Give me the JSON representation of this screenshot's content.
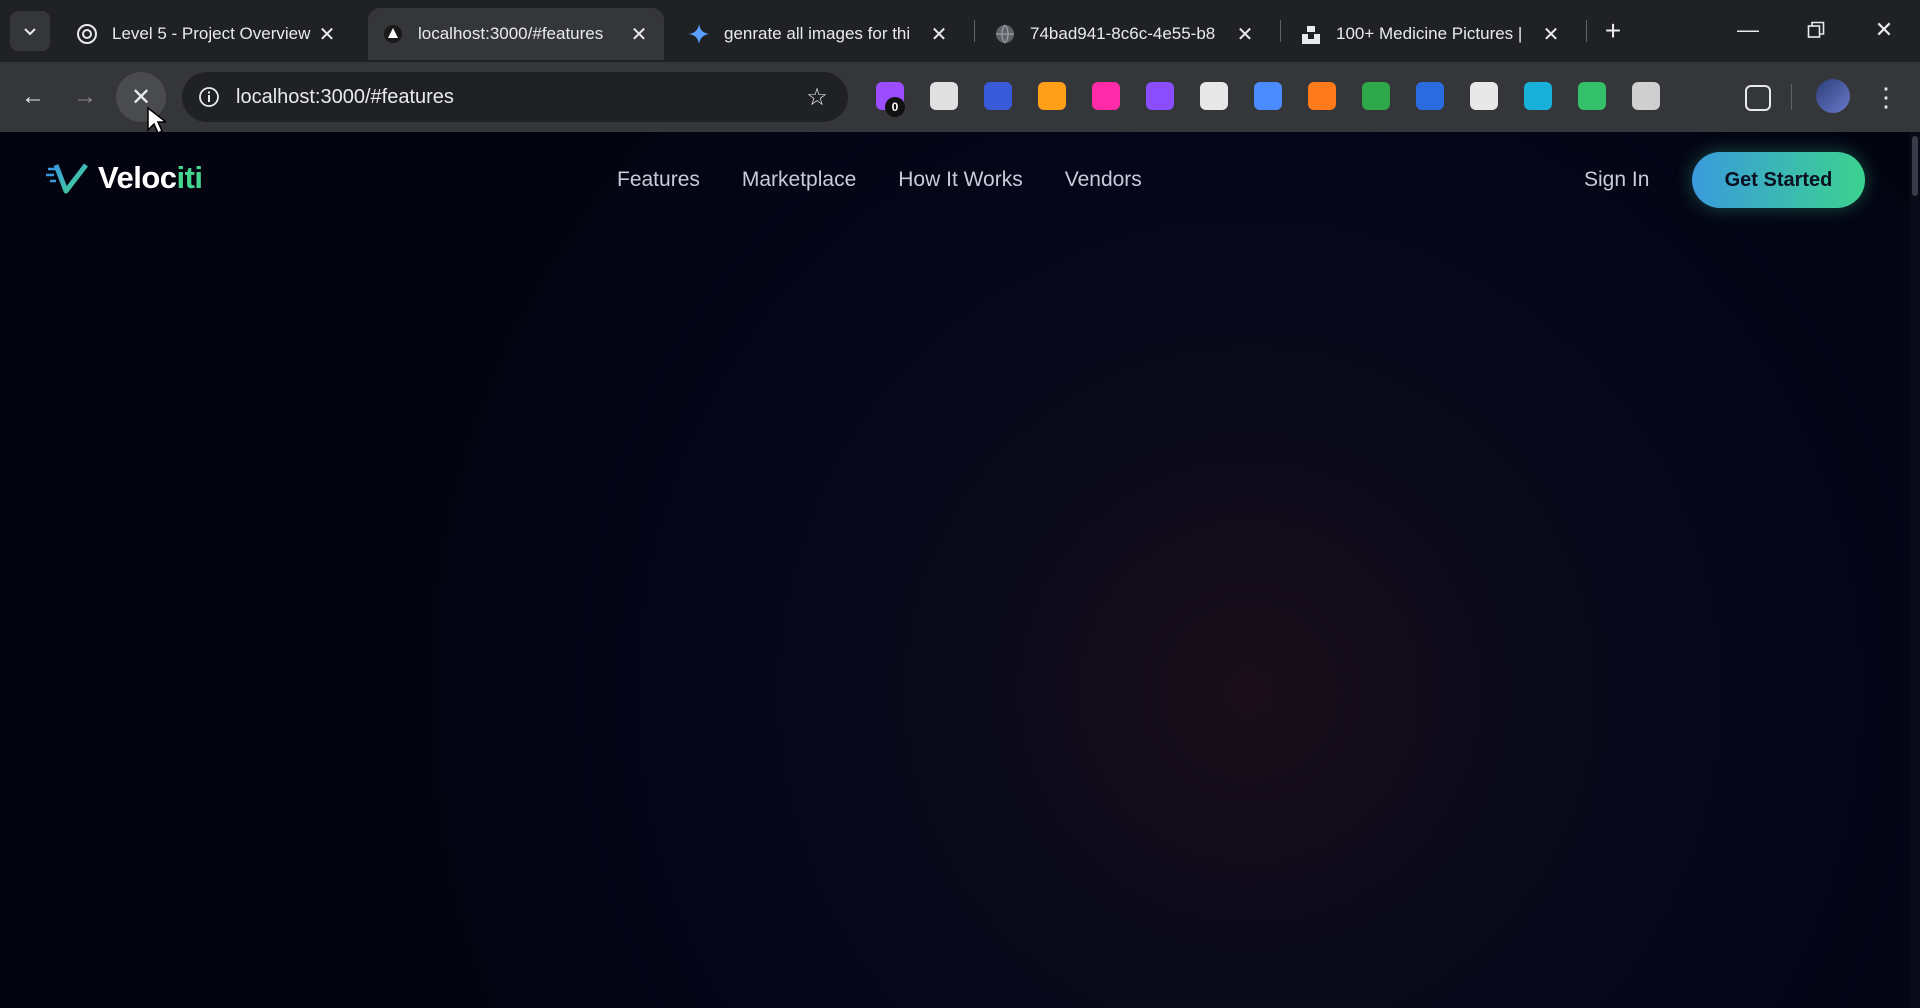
{
  "browser": {
    "tabs": [
      {
        "title": "Level 5 - Project Overview",
        "icon": "openai-icon",
        "active": false
      },
      {
        "title": "localhost:3000/#features",
        "icon": "app-icon",
        "active": true
      },
      {
        "title": "genrate all images for thi",
        "icon": "gemini-icon",
        "active": false
      },
      {
        "title": "74bad941-8c6c-4e55-b8",
        "icon": "globe-icon",
        "active": false
      },
      {
        "title": "100+ Medicine Pictures |",
        "icon": "unsplash-icon",
        "active": false
      }
    ],
    "url": "localhost:3000/#features",
    "extension_badge": "0",
    "extension_colors": [
      "#9b4dff",
      "#e0e0e0",
      "#3a5bd9",
      "#ff9f1a",
      "#ff2aa8",
      "#8a4dff",
      "#e8e8e8",
      "#4a8cff",
      "#ff7a1a",
      "#2ea84a",
      "#2a6be0",
      "#e8e8e8",
      "#18b0d9",
      "#35c16a",
      "#cfcfcf",
      "#7a3df0"
    ]
  },
  "site": {
    "brand": {
      "name_main": "Veloc",
      "name_accent": "iti"
    },
    "nav": [
      "Features",
      "Marketplace",
      "How It Works",
      "Vendors"
    ],
    "sign_in": "Sign In",
    "cta": "Get Started",
    "colors": {
      "background": "#03040f",
      "accent_green": "#44d58e",
      "accent_blue": "#3a9bdc"
    }
  }
}
